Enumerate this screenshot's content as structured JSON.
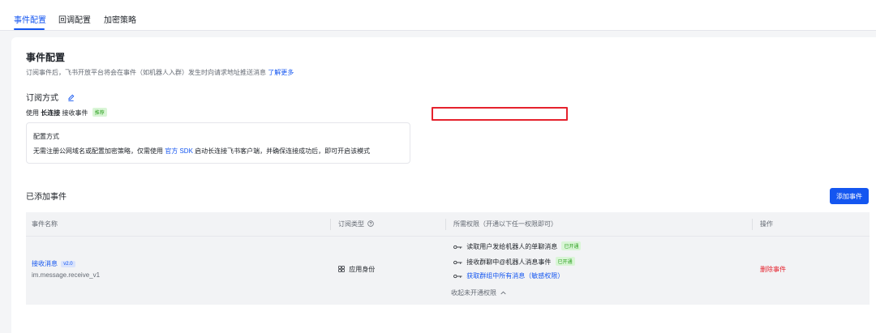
{
  "tabs": [
    {
      "label": "事件配置",
      "active": true
    },
    {
      "label": "回调配置",
      "active": false
    },
    {
      "label": "加密策略",
      "active": false
    }
  ],
  "event_config": {
    "title": "事件配置",
    "description": "订阅事件后，飞书开放平台将会在事件（如机器人入群）发生时向请求地址推送消息",
    "learn_more": "了解更多"
  },
  "subscription": {
    "title": "订阅方式",
    "use_prefix": "使用",
    "mode": "长连接",
    "use_suffix": "接收事件",
    "badge": "推荐"
  },
  "config_box": {
    "title": "配置方式",
    "desc_before": "无需注册公网域名或配置加密策略，仅需使用",
    "sdk_link": "官方 SDK",
    "desc_after": "启动长连接飞书客户端，并确保连接成功后，即可开启该模式"
  },
  "added_events": {
    "title": "已添加事件",
    "add_button": "添加事件"
  },
  "table": {
    "headers": {
      "name": "事件名称",
      "type": "订阅类型",
      "perms": "所需权限（开通以下任一权限即可）",
      "action": "操作"
    },
    "row": {
      "event_name": "接收消息",
      "version": "v2.0",
      "event_code": "im.message.receive_v1",
      "sub_type": "应用身份",
      "permissions": [
        {
          "text": "读取用户发给机器人的单聊消息",
          "badge": "已开通"
        },
        {
          "text": "接收群聊中@机器人消息事件",
          "badge": "已开通"
        },
        {
          "text": "获取群组中所有消息（敏感权限）",
          "badge": ""
        }
      ],
      "collapse": "收起未开通权限",
      "delete": "删除事件"
    }
  },
  "colors": {
    "accent": "#1456f0",
    "danger": "#e5222d",
    "success": "#2ea121",
    "header_bg": "#f2f3f5"
  }
}
